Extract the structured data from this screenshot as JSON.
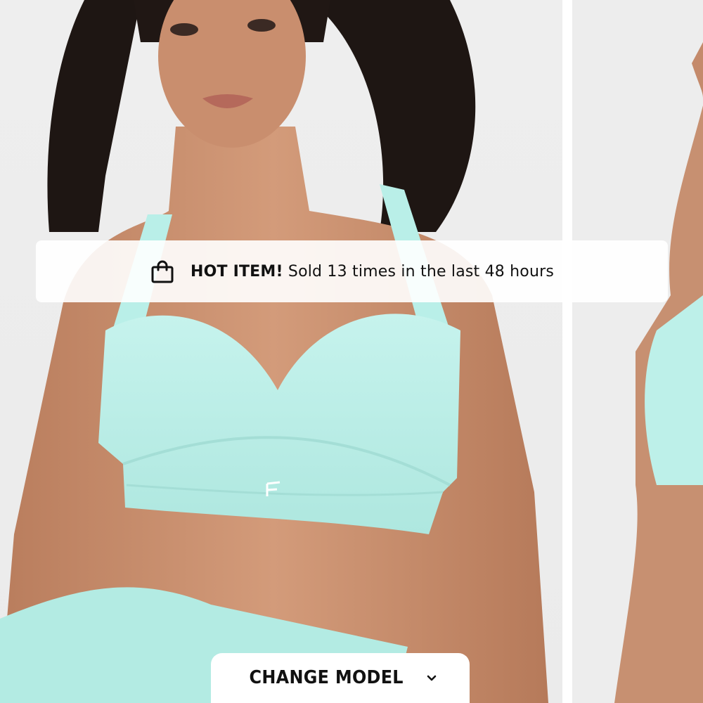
{
  "gallery": {
    "main_image": "model-wearing-mint-sports-bra",
    "second_image": "model-side-view"
  },
  "banner": {
    "icon": "shopping-bag-icon",
    "strong_text": "HOT ITEM!",
    "text": " Sold 13 times in the last 48 hours"
  },
  "change_model": {
    "label": "CHANGE MODEL",
    "icon": "chevron-down-icon"
  },
  "colors": {
    "product": "#bff0ea",
    "background": "#ececec",
    "skin": "#c98e6e",
    "hair": "#1e1613"
  }
}
